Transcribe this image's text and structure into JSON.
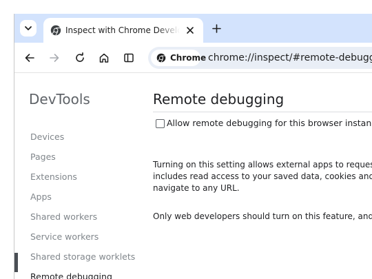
{
  "browser": {
    "tab": {
      "title": "Inspect with Chrome Developer Tools"
    },
    "omnibox": {
      "chip_label": "Chrome",
      "url": "chrome://inspect/#remote-debugging"
    }
  },
  "sidebar": {
    "title": "DevTools",
    "items": [
      {
        "label": "Devices"
      },
      {
        "label": "Pages"
      },
      {
        "label": "Extensions"
      },
      {
        "label": "Apps"
      },
      {
        "label": "Shared workers"
      },
      {
        "label": "Service workers"
      },
      {
        "label": "Shared storage worklets"
      },
      {
        "label": "Remote debugging"
      }
    ],
    "selected_index": 7
  },
  "main": {
    "title": "Remote debugging",
    "checkbox": {
      "label": "Allow remote debugging for this browser instance",
      "checked": false
    },
    "paragraph1": [
      "Turning on this setting allows external apps to request f",
      "includes read access to your saved data, cookies and site",
      "navigate to any URL."
    ],
    "paragraph2": "Only web developers should turn on this feature, and on"
  },
  "colors": {
    "tabstrip": "#d3e3fd",
    "omnibox": "#e9eef6",
    "nav_indicator": "#4a4f55",
    "nav_text": "#80868b"
  }
}
